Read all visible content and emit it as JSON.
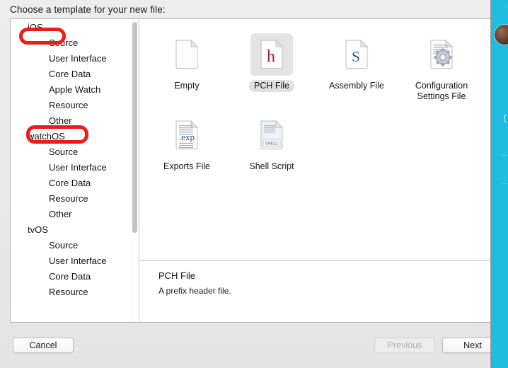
{
  "dialog": {
    "prompt": "Choose a template for your new file:"
  },
  "sidebar": {
    "groups": [
      {
        "label": "iOS",
        "items": [
          "Source",
          "User Interface",
          "Core Data",
          "Apple Watch",
          "Resource",
          "Other"
        ]
      },
      {
        "label": "watchOS",
        "items": [
          "Source",
          "User Interface",
          "Core Data",
          "Resource",
          "Other"
        ]
      },
      {
        "label": "tvOS",
        "items": [
          "Source",
          "User Interface",
          "Core Data",
          "Resource"
        ]
      }
    ]
  },
  "templates": [
    {
      "label": "Empty",
      "icon": "blank-document-icon",
      "selected": false
    },
    {
      "label": "PCH File",
      "icon": "pch-file-icon",
      "selected": true
    },
    {
      "label": "Assembly File",
      "icon": "assembly-file-icon",
      "selected": false
    },
    {
      "label": "Configuration Settings File",
      "icon": "config-settings-icon",
      "selected": false
    },
    {
      "label": "Exports File",
      "icon": "exports-file-icon",
      "selected": false
    },
    {
      "label": "Shell Script",
      "icon": "shell-script-icon",
      "selected": false
    }
  ],
  "description": {
    "title": "PCH File",
    "body": "A prefix header file."
  },
  "footer": {
    "cancel": "Cancel",
    "previous": "Previous",
    "next": "Next"
  },
  "annotations": {
    "accent_color": "#f01a17",
    "targets": [
      "iOS",
      "Other"
    ]
  },
  "background_app": {
    "accent_color": "#1fbcdf"
  }
}
